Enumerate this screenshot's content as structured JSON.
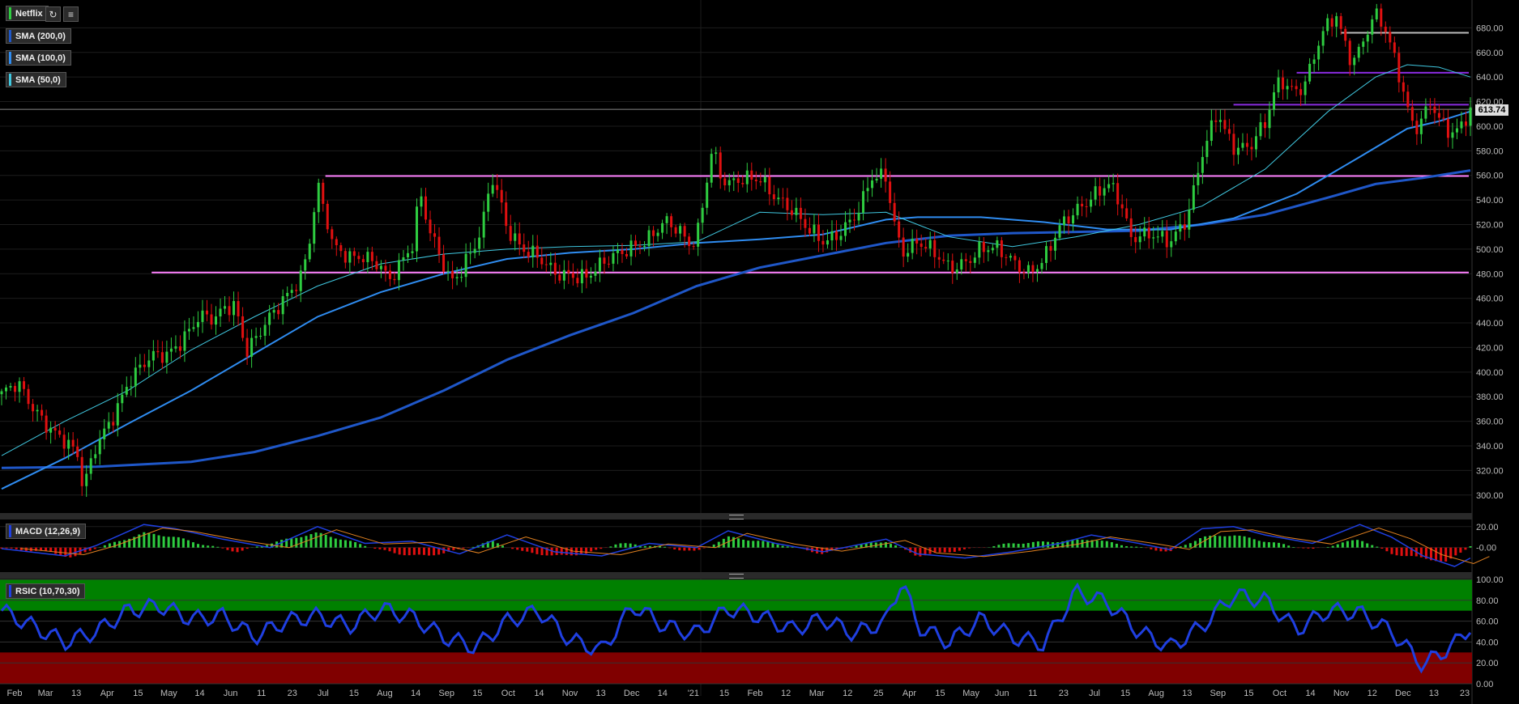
{
  "symbol_tab": {
    "label": "Netflix",
    "color": "#2ecc40"
  },
  "toolbar": {
    "refresh_icon": "refresh-icon",
    "settings_icon": "indicator-settings-icon"
  },
  "indicators": {
    "sma200": {
      "label": "SMA (200,0)",
      "color": "#1f57c8"
    },
    "sma100": {
      "label": "SMA (100,0)",
      "color": "#2f8cf0"
    },
    "sma50": {
      "label": "SMA (50,0)",
      "color": "#40c8e0"
    },
    "macd": {
      "label": "MACD (12,26,9)",
      "color": "#1f3fe0"
    },
    "rsi": {
      "label": "RSIC (10,70,30)",
      "color": "#1f3fe0"
    }
  },
  "last_price": {
    "value": "613.74"
  },
  "price_axis": {
    "ticks": [
      "300.00",
      "320.00",
      "340.00",
      "360.00",
      "380.00",
      "400.00",
      "420.00",
      "440.00",
      "460.00",
      "480.00",
      "500.00",
      "520.00",
      "540.00",
      "560.00",
      "580.00",
      "600.00",
      "620.00",
      "640.00",
      "660.00",
      "680.00"
    ]
  },
  "macd_axis": {
    "ticks": [
      "20.00",
      "-0.00"
    ]
  },
  "rsi_axis": {
    "ticks": [
      "100.00",
      "80.00",
      "60.00",
      "40.00",
      "20.00",
      "0.00"
    ]
  },
  "time_axis": {
    "labels": [
      "Feb",
      "Mar",
      "13",
      "Apr",
      "15",
      "May",
      "14",
      "Jun",
      "11",
      "23",
      "Jul",
      "15",
      "Aug",
      "14",
      "Sep",
      "15",
      "Oct",
      "14",
      "Nov",
      "13",
      "Dec",
      "14",
      "'21",
      "15",
      "Feb",
      "12",
      "Mar",
      "12",
      "25",
      "Apr",
      "15",
      "May",
      "Jun",
      "11",
      "23",
      "Jul",
      "15",
      "Aug",
      "13",
      "Sep",
      "15",
      "Oct",
      "14",
      "Nov",
      "12",
      "Dec",
      "13",
      "23"
    ]
  },
  "colors": {
    "up": "#2ecc40",
    "down": "#e01010",
    "support": "#ff80ff",
    "resistance_purple": "#8a2ce0",
    "grey_level": "#bbbbbb",
    "rsi_overbought": "#008000",
    "rsi_oversold": "#800000"
  },
  "chart_data": {
    "type": "candlestick",
    "symbol": "Netflix",
    "price_range": [
      288,
      700
    ],
    "close_series": [
      [
        0,
        382
      ],
      [
        10,
        388
      ],
      [
        20,
        370
      ],
      [
        30,
        358
      ],
      [
        40,
        345
      ],
      [
        48,
        330
      ],
      [
        52,
        300
      ],
      [
        55,
        318
      ],
      [
        60,
        340
      ],
      [
        70,
        365
      ],
      [
        80,
        392
      ],
      [
        88,
        402
      ],
      [
        95,
        410
      ],
      [
        105,
        415
      ],
      [
        115,
        430
      ],
      [
        125,
        445
      ],
      [
        135,
        440
      ],
      [
        142,
        452
      ],
      [
        148,
        455
      ],
      [
        155,
        420
      ],
      [
        165,
        436
      ],
      [
        175,
        450
      ],
      [
        182,
        462
      ],
      [
        190,
        480
      ],
      [
        195,
        510
      ],
      [
        200,
        555
      ],
      [
        205,
        530
      ],
      [
        210,
        500
      ],
      [
        220,
        490
      ],
      [
        230,
        495
      ],
      [
        240,
        490
      ],
      [
        245,
        475
      ],
      [
        255,
        490
      ],
      [
        260,
        500
      ],
      [
        265,
        545
      ],
      [
        270,
        520
      ],
      [
        275,
        505
      ],
      [
        280,
        490
      ],
      [
        285,
        475
      ],
      [
        290,
        480
      ],
      [
        300,
        500
      ],
      [
        305,
        520
      ],
      [
        310,
        560
      ],
      [
        315,
        545
      ],
      [
        320,
        520
      ],
      [
        330,
        500
      ],
      [
        340,
        490
      ],
      [
        350,
        480
      ],
      [
        360,
        482
      ],
      [
        370,
        478
      ],
      [
        380,
        485
      ],
      [
        390,
        495
      ],
      [
        400,
        505
      ],
      [
        410,
        510
      ],
      [
        420,
        520
      ],
      [
        430,
        512
      ],
      [
        435,
        505
      ],
      [
        440,
        510
      ],
      [
        450,
        585
      ],
      [
        455,
        560
      ],
      [
        460,
        550
      ],
      [
        470,
        555
      ],
      [
        480,
        560
      ],
      [
        490,
        545
      ],
      [
        500,
        530
      ],
      [
        510,
        515
      ],
      [
        520,
        508
      ],
      [
        530,
        515
      ],
      [
        540,
        525
      ],
      [
        545,
        535
      ],
      [
        550,
        555
      ],
      [
        560,
        560
      ],
      [
        565,
        525
      ],
      [
        570,
        500
      ],
      [
        580,
        505
      ],
      [
        590,
        495
      ],
      [
        600,
        485
      ],
      [
        610,
        492
      ],
      [
        620,
        500
      ],
      [
        630,
        498
      ],
      [
        640,
        490
      ],
      [
        650,
        484
      ],
      [
        660,
        492
      ],
      [
        670,
        515
      ],
      [
        680,
        530
      ],
      [
        690,
        545
      ],
      [
        700,
        555
      ],
      [
        705,
        545
      ],
      [
        710,
        530
      ],
      [
        715,
        505
      ],
      [
        720,
        510
      ],
      [
        730,
        515
      ],
      [
        740,
        508
      ],
      [
        750,
        520
      ],
      [
        755,
        545
      ],
      [
        760,
        575
      ],
      [
        765,
        595
      ],
      [
        770,
        615
      ],
      [
        775,
        598
      ],
      [
        780,
        585
      ],
      [
        790,
        580
      ],
      [
        800,
        600
      ],
      [
        805,
        625
      ],
      [
        810,
        640
      ],
      [
        815,
        635
      ],
      [
        820,
        630
      ],
      [
        825,
        635
      ],
      [
        830,
        650
      ],
      [
        835,
        670
      ],
      [
        840,
        680
      ],
      [
        845,
        690
      ],
      [
        850,
        670
      ],
      [
        855,
        655
      ],
      [
        860,
        665
      ],
      [
        865,
        680
      ],
      [
        870,
        690
      ],
      [
        875,
        680
      ],
      [
        880,
        660
      ],
      [
        885,
        640
      ],
      [
        890,
        615
      ],
      [
        895,
        600
      ],
      [
        900,
        610
      ],
      [
        905,
        622
      ],
      [
        910,
        605
      ],
      [
        915,
        595
      ],
      [
        920,
        590
      ],
      [
        925,
        600
      ],
      [
        930,
        613.74
      ]
    ],
    "sma200": [
      [
        0,
        322
      ],
      [
        60,
        323
      ],
      [
        120,
        327
      ],
      [
        160,
        335
      ],
      [
        200,
        348
      ],
      [
        240,
        363
      ],
      [
        280,
        385
      ],
      [
        320,
        410
      ],
      [
        360,
        430
      ],
      [
        400,
        448
      ],
      [
        440,
        470
      ],
      [
        480,
        485
      ],
      [
        520,
        495
      ],
      [
        560,
        505
      ],
      [
        600,
        511
      ],
      [
        640,
        513
      ],
      [
        680,
        514
      ],
      [
        720,
        515
      ],
      [
        760,
        520
      ],
      [
        800,
        528
      ],
      [
        840,
        542
      ],
      [
        870,
        553
      ],
      [
        900,
        558
      ],
      [
        930,
        564
      ]
    ],
    "sma100": [
      [
        0,
        305
      ],
      [
        40,
        330
      ],
      [
        80,
        358
      ],
      [
        120,
        385
      ],
      [
        160,
        415
      ],
      [
        200,
        445
      ],
      [
        240,
        465
      ],
      [
        280,
        480
      ],
      [
        320,
        492
      ],
      [
        360,
        497
      ],
      [
        400,
        500
      ],
      [
        440,
        505
      ],
      [
        480,
        508
      ],
      [
        520,
        512
      ],
      [
        560,
        524
      ],
      [
        580,
        526
      ],
      [
        620,
        526
      ],
      [
        660,
        522
      ],
      [
        700,
        516
      ],
      [
        740,
        516
      ],
      [
        780,
        525
      ],
      [
        820,
        545
      ],
      [
        860,
        575
      ],
      [
        890,
        598
      ],
      [
        910,
        604
      ],
      [
        930,
        612
      ]
    ],
    "sma50": [
      [
        0,
        332
      ],
      [
        40,
        360
      ],
      [
        80,
        385
      ],
      [
        120,
        418
      ],
      [
        160,
        445
      ],
      [
        200,
        470
      ],
      [
        240,
        488
      ],
      [
        280,
        496
      ],
      [
        320,
        500
      ],
      [
        360,
        502
      ],
      [
        400,
        503
      ],
      [
        440,
        506
      ],
      [
        480,
        530
      ],
      [
        520,
        528
      ],
      [
        560,
        530
      ],
      [
        600,
        510
      ],
      [
        640,
        502
      ],
      [
        680,
        510
      ],
      [
        720,
        520
      ],
      [
        760,
        535
      ],
      [
        800,
        565
      ],
      [
        840,
        612
      ],
      [
        870,
        640
      ],
      [
        890,
        650
      ],
      [
        910,
        648
      ],
      [
        930,
        640
      ]
    ],
    "levels": [
      {
        "price": 481,
        "from": 95,
        "to": 930,
        "color": "#ff80ff"
      },
      {
        "price": 559.5,
        "from": 205,
        "to": 930,
        "color": "#ff80ff"
      },
      {
        "price": 617.5,
        "from": 780,
        "to": 930,
        "color": "#8a2ce0"
      },
      {
        "price": 643.5,
        "from": 820,
        "to": 930,
        "color": "#8a2ce0"
      },
      {
        "price": 676,
        "from": 848,
        "to": 930,
        "color": "#bbbbbb"
      }
    ],
    "macd_range": [
      -18,
      26
    ],
    "rsi_range": [
      0,
      100
    ],
    "rsi_overbought": 70,
    "rsi_oversold": 30,
    "rsi_series": [
      [
        0,
        70
      ],
      [
        20,
        55
      ],
      [
        40,
        40
      ],
      [
        60,
        50
      ],
      [
        80,
        70
      ],
      [
        100,
        75
      ],
      [
        120,
        62
      ],
      [
        140,
        65
      ],
      [
        160,
        45
      ],
      [
        180,
        60
      ],
      [
        200,
        65
      ],
      [
        220,
        55
      ],
      [
        240,
        72
      ],
      [
        260,
        64
      ],
      [
        280,
        45
      ],
      [
        300,
        35
      ],
      [
        320,
        60
      ],
      [
        340,
        70
      ],
      [
        360,
        42
      ],
      [
        380,
        32
      ],
      [
        400,
        75
      ],
      [
        420,
        55
      ],
      [
        440,
        48
      ],
      [
        460,
        72
      ],
      [
        480,
        65
      ],
      [
        500,
        52
      ],
      [
        520,
        62
      ],
      [
        540,
        48
      ],
      [
        560,
        60
      ],
      [
        570,
        100
      ],
      [
        580,
        55
      ],
      [
        600,
        40
      ],
      [
        620,
        62
      ],
      [
        640,
        45
      ],
      [
        660,
        38
      ],
      [
        680,
        88
      ],
      [
        700,
        78
      ],
      [
        720,
        50
      ],
      [
        740,
        35
      ],
      [
        760,
        55
      ],
      [
        780,
        85
      ],
      [
        800,
        80
      ],
      [
        820,
        52
      ],
      [
        840,
        70
      ],
      [
        860,
        68
      ],
      [
        880,
        50
      ],
      [
        900,
        18
      ],
      [
        920,
        38
      ],
      [
        930,
        55
      ]
    ],
    "macd_series": [
      [
        0,
        -1
      ],
      [
        40,
        -8
      ],
      [
        60,
        2
      ],
      [
        90,
        22
      ],
      [
        110,
        18
      ],
      [
        140,
        8
      ],
      [
        170,
        0
      ],
      [
        200,
        20
      ],
      [
        230,
        4
      ],
      [
        260,
        6
      ],
      [
        290,
        -6
      ],
      [
        320,
        12
      ],
      [
        350,
        -4
      ],
      [
        380,
        -8
      ],
      [
        410,
        4
      ],
      [
        440,
        0
      ],
      [
        460,
        16
      ],
      [
        490,
        4
      ],
      [
        520,
        -4
      ],
      [
        560,
        8
      ],
      [
        580,
        -6
      ],
      [
        610,
        -10
      ],
      [
        640,
        -4
      ],
      [
        670,
        4
      ],
      [
        690,
        12
      ],
      [
        720,
        4
      ],
      [
        740,
        -2
      ],
      [
        760,
        18
      ],
      [
        780,
        20
      ],
      [
        800,
        12
      ],
      [
        830,
        4
      ],
      [
        860,
        22
      ],
      [
        880,
        10
      ],
      [
        900,
        -8
      ],
      [
        920,
        -18
      ],
      [
        930,
        -10
      ]
    ],
    "histogram": [
      [
        0,
        -1
      ],
      [
        30,
        -4
      ],
      [
        45,
        -10
      ],
      [
        60,
        0
      ],
      [
        75,
        6
      ],
      [
        90,
        14
      ],
      [
        110,
        10
      ],
      [
        130,
        2
      ],
      [
        150,
        -4
      ],
      [
        175,
        6
      ],
      [
        200,
        14
      ],
      [
        220,
        6
      ],
      [
        250,
        -6
      ],
      [
        270,
        -8
      ],
      [
        290,
        -2
      ],
      [
        310,
        6
      ],
      [
        330,
        -4
      ],
      [
        350,
        -8
      ],
      [
        370,
        -6
      ],
      [
        390,
        4
      ],
      [
        410,
        2
      ],
      [
        440,
        -4
      ],
      [
        460,
        10
      ],
      [
        490,
        4
      ],
      [
        520,
        -6
      ],
      [
        540,
        2
      ],
      [
        560,
        6
      ],
      [
        580,
        -8
      ],
      [
        610,
        -2
      ],
      [
        640,
        4
      ],
      [
        670,
        6
      ],
      [
        690,
        8
      ],
      [
        720,
        0
      ],
      [
        740,
        -4
      ],
      [
        760,
        10
      ],
      [
        780,
        12
      ],
      [
        800,
        6
      ],
      [
        830,
        -2
      ],
      [
        860,
        8
      ],
      [
        880,
        -6
      ],
      [
        900,
        -10
      ],
      [
        915,
        -14
      ],
      [
        930,
        2
      ]
    ]
  }
}
